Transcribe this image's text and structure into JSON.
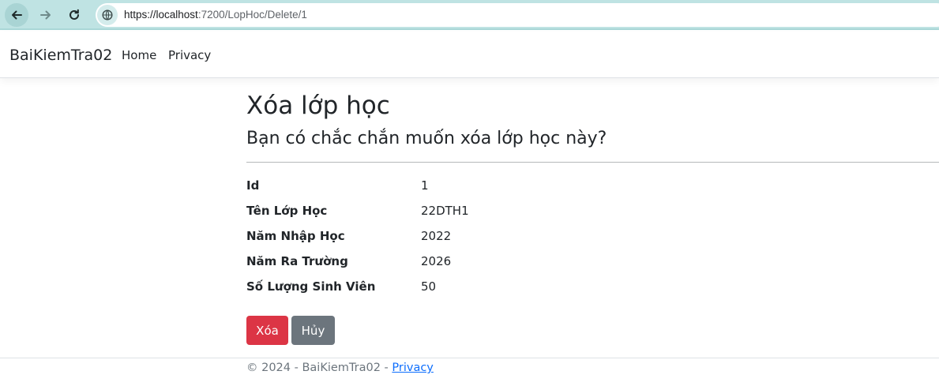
{
  "browser": {
    "url": "https://localhost:7200/LopHoc/Delete/1",
    "url_host": "https://localhost",
    "url_rest": ":7200/LopHoc/Delete/1"
  },
  "navbar": {
    "brand": "BaiKiemTra02",
    "links": [
      "Home",
      "Privacy"
    ]
  },
  "main": {
    "title": "Xóa lớp học",
    "subtitle": "Bạn có chắc chắn muốn xóa lớp học này?",
    "details": [
      {
        "label": "Id",
        "value": "1"
      },
      {
        "label": "Tên Lớp Học",
        "value": "22DTH1"
      },
      {
        "label": "Năm Nhập Học",
        "value": "2022"
      },
      {
        "label": "Năm Ra Trường",
        "value": "2026"
      },
      {
        "label": "Số Lượng Sinh Viên",
        "value": "50"
      }
    ],
    "delete_label": "Xóa",
    "cancel_label": "Hủy"
  },
  "footer": {
    "text": "© 2024 - BaiKiemTra02 - ",
    "link": "Privacy"
  },
  "colors": {
    "browser_chrome": "#bfe3e3",
    "delete_button": "#dc3545",
    "cancel_button": "#6c757d",
    "link": "#0d6efd"
  },
  "icons": {
    "back": "arrow-left-icon",
    "forward": "arrow-right-icon",
    "reload": "reload-icon",
    "site_info": "site-info-icon"
  }
}
